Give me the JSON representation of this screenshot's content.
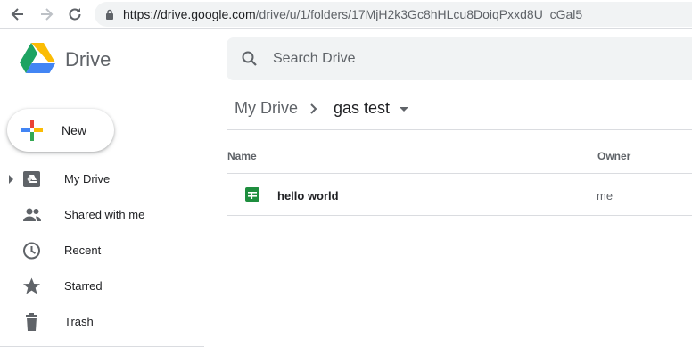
{
  "browser": {
    "url_host": "https://drive.google.com",
    "url_path": "/drive/u/1/folders/17MjH2k3Gc8hHLcu8DoiqPxxd8U_cGal5"
  },
  "app": {
    "name": "Drive",
    "logo_icon": "google-drive-logo"
  },
  "search": {
    "placeholder": "Search Drive"
  },
  "sidebar": {
    "new_label": "New",
    "items": [
      {
        "label": "My Drive",
        "icon": "my-drive-icon",
        "expandable": true
      },
      {
        "label": "Shared with me",
        "icon": "people-icon"
      },
      {
        "label": "Recent",
        "icon": "clock-icon"
      },
      {
        "label": "Starred",
        "icon": "star-icon"
      },
      {
        "label": "Trash",
        "icon": "trash-icon"
      }
    ]
  },
  "breadcrumb": {
    "root": "My Drive",
    "current": "gas test"
  },
  "table": {
    "columns": [
      "Name",
      "Owner"
    ],
    "rows": [
      {
        "name": "hello world",
        "owner": "me",
        "type_icon": "google-sheets-icon"
      }
    ]
  },
  "colors": {
    "sheets_green": "#1e8e3e",
    "icon_gray": "#5f6368",
    "search_bg": "#f1f3f4",
    "divider": "#dadce0"
  }
}
